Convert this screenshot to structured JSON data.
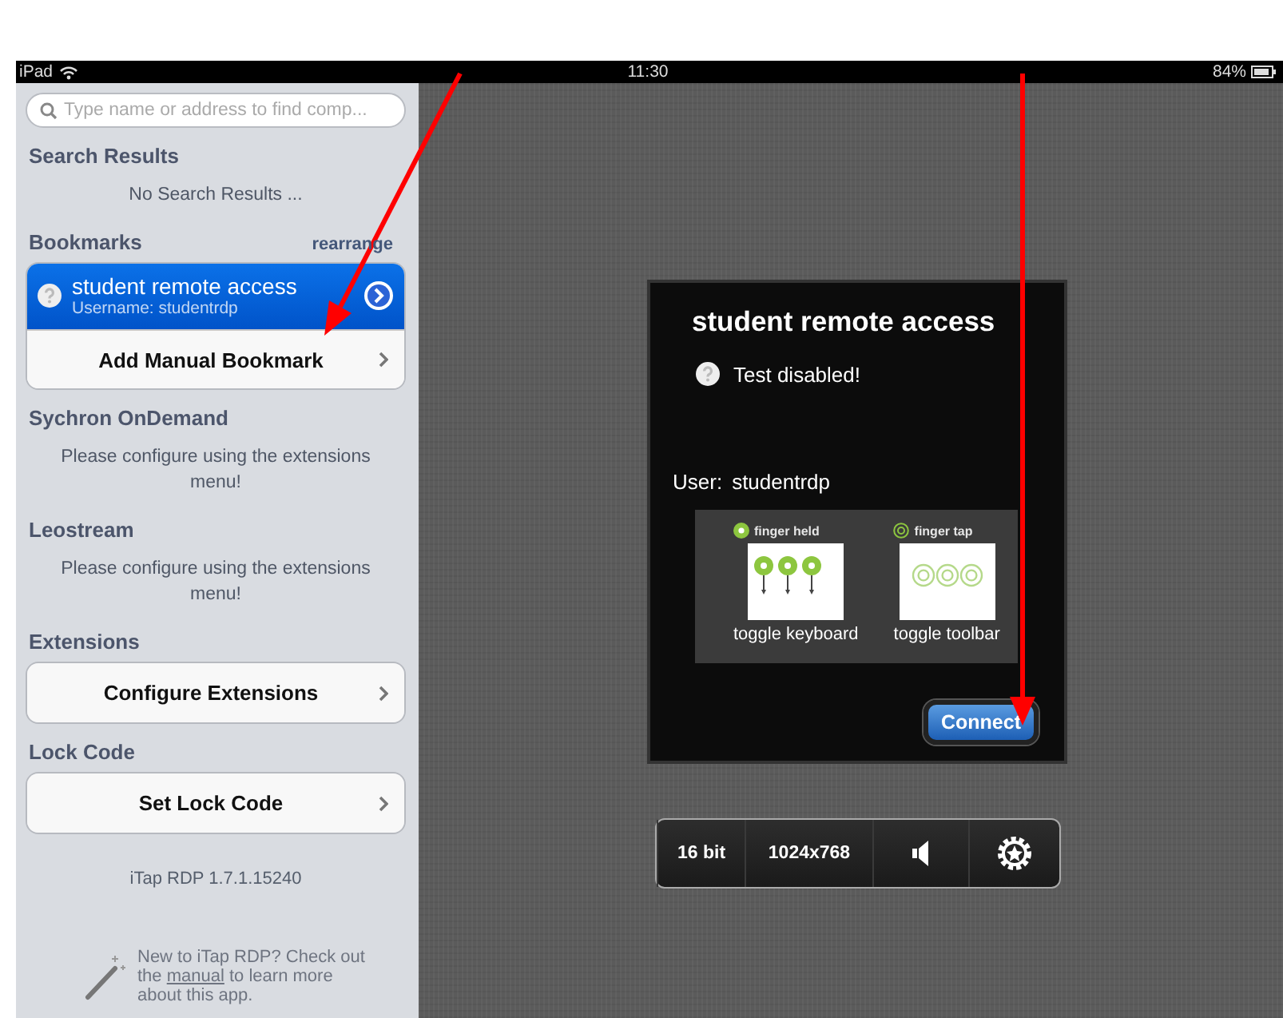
{
  "status_bar": {
    "carrier": "iPad",
    "time": "11:30",
    "battery": "84%"
  },
  "sidebar": {
    "search": {
      "placeholder": "Type name or address to find comp..."
    },
    "sections": [
      {
        "title": "Search Results",
        "message": "No Search Results ..."
      },
      {
        "title": "Bookmarks",
        "action": "rearrange",
        "items": [
          {
            "kind": "bookmark",
            "title": "student remote access",
            "subtitle": "Username: studentrdp",
            "selected": true
          },
          {
            "kind": "link",
            "label": "Add Manual Bookmark"
          }
        ]
      },
      {
        "title": "Sychron OnDemand",
        "message": "Please configure using the extensions menu!"
      },
      {
        "title": "Leostream",
        "message": "Please configure using the extensions menu!"
      },
      {
        "title": "Extensions",
        "items": [
          {
            "kind": "link",
            "label": "Configure Extensions"
          }
        ]
      },
      {
        "title": "Lock Code",
        "items": [
          {
            "kind": "link",
            "label": "Set Lock Code"
          }
        ]
      }
    ],
    "version": "iTap RDP 1.7.1.15240",
    "help": {
      "before": "New to iTap RDP? Check out the",
      "link": "manual",
      "after": "to learn more about this app."
    }
  },
  "dialog": {
    "title": "student remote access",
    "status": "Test disabled!",
    "user_label": "User:",
    "user": "studentrdp",
    "gestures": [
      {
        "kind": "held",
        "hint": "finger held",
        "caption": "toggle keyboard"
      },
      {
        "kind": "tap",
        "hint": "finger tap",
        "caption": "toggle toolbar"
      }
    ],
    "button": "Connect"
  },
  "toolbar": {
    "items": [
      {
        "kind": "text",
        "label": "16 bit"
      },
      {
        "kind": "text",
        "label": "1024x768"
      },
      {
        "kind": "speaker"
      },
      {
        "kind": "settings"
      }
    ]
  }
}
